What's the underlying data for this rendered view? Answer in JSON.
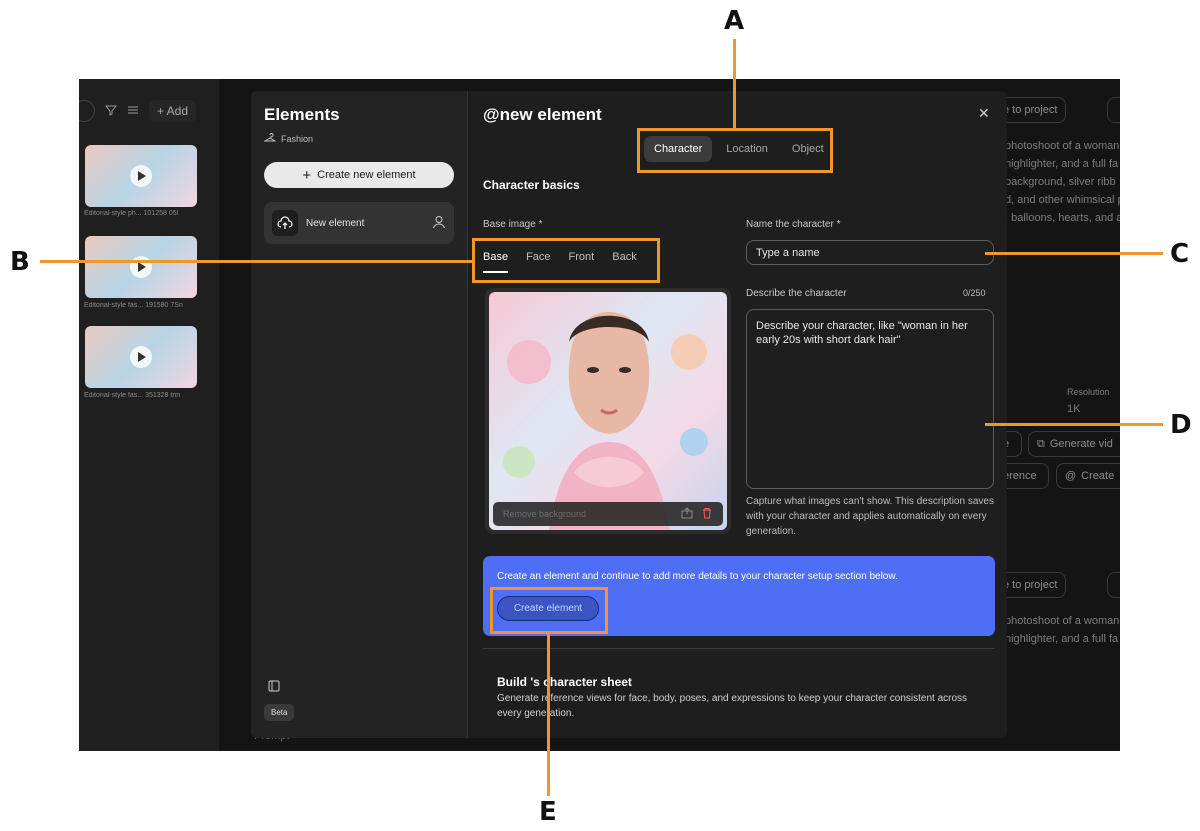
{
  "annotations": {
    "a": "A",
    "b": "B",
    "c": "C",
    "d": "D",
    "e": "E"
  },
  "background": {
    "add_label": "+ Add",
    "thumbs": [
      {
        "label": "Editorial-style ph... 101258 05l"
      },
      {
        "label": "Editorial-style fas... 191580 7Sn"
      },
      {
        "label": "Editorial-style fas... 351328 tnn"
      }
    ],
    "to_project": "e to project",
    "to_project_2": "e to project",
    "right_text": [
      "photoshoot of a woman",
      "highlighter, and a full fa",
      "background, silver ribb",
      "d, and other whimsical p",
      ", balloons, hearts, and a"
    ],
    "right_text_2": [
      "photoshoot of a woman",
      "highlighter, and a full fa"
    ],
    "resolution_label": "Resolution",
    "resolution_value": "1K",
    "chip_e": "e",
    "chip_generate_video": "Generate vid",
    "chip_reference": "erence",
    "chip_create": "Create",
    "prompt_label": "Prompt -"
  },
  "sidebar": {
    "title": "Elements",
    "subtitle": "Fashion",
    "create_new": "Create new element",
    "new_element": "New element",
    "beta": "Beta"
  },
  "main": {
    "title": "@new element",
    "tabs": [
      {
        "label": "Character",
        "active": true
      },
      {
        "label": "Location",
        "active": false
      },
      {
        "label": "Object",
        "active": false
      }
    ],
    "section_title": "Character basics",
    "base_image_label": "Base image *",
    "subtabs": [
      {
        "label": "Base",
        "active": true
      },
      {
        "label": "Face",
        "active": false
      },
      {
        "label": "Front",
        "active": false
      },
      {
        "label": "Back",
        "active": false
      }
    ],
    "remove_background": "Remove background",
    "name_label": "Name the character *",
    "name_placeholder": "Type a name",
    "describe_label": "Describe the character",
    "counter": "0/250",
    "describe_placeholder": "Describe your character, like \"woman in her early 20s with short dark hair\"",
    "hint": "Capture what images can't show. This description saves with your character and applies automatically on every generation.",
    "blue_text": "Create an element and continue to add more details to your character setup section below.",
    "create_element": "Create element",
    "sheet_title": "Build 's character sheet",
    "sheet_desc": "Generate reference views for face, body, poses, and expressions to keep your character consistent across every generation."
  }
}
